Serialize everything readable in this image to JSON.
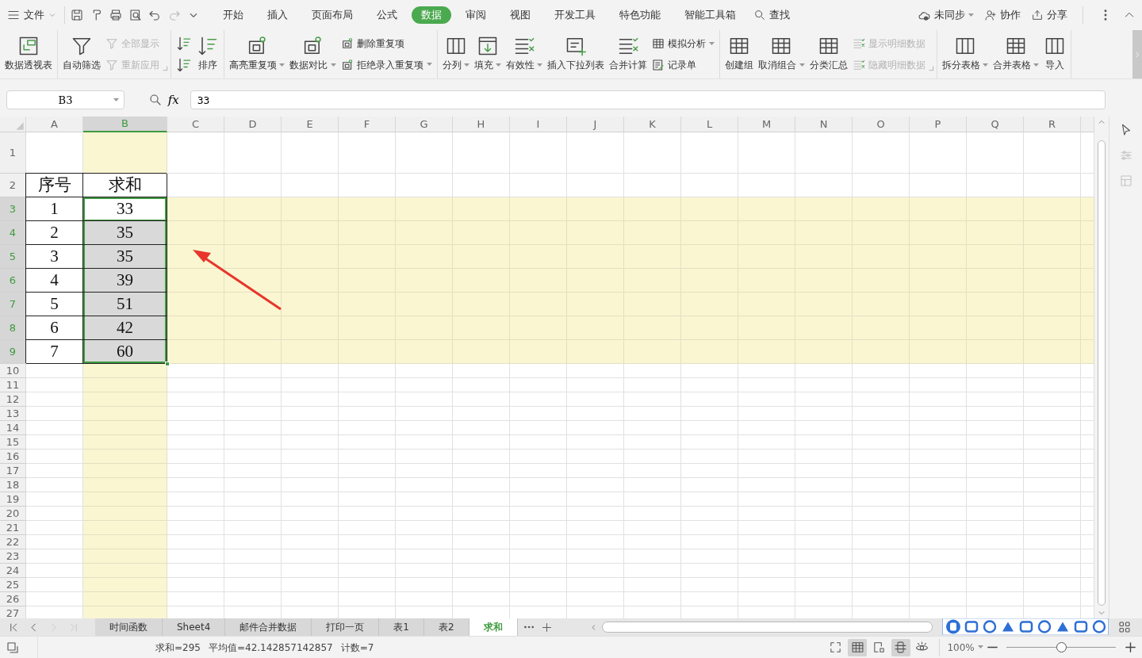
{
  "title_bar": {
    "file_menu": "文件",
    "tabs": [
      {
        "label": "开始",
        "selected": false
      },
      {
        "label": "插入",
        "selected": false
      },
      {
        "label": "页面布局",
        "selected": false
      },
      {
        "label": "公式",
        "selected": false
      },
      {
        "label": "数据",
        "selected": true
      },
      {
        "label": "审阅",
        "selected": false
      },
      {
        "label": "视图",
        "selected": false
      },
      {
        "label": "开发工具",
        "selected": false
      },
      {
        "label": "特色功能",
        "selected": false
      },
      {
        "label": "智能工具箱",
        "selected": false
      }
    ],
    "search": "查找",
    "sync": "未同步",
    "collaborate": "协作",
    "share": "分享"
  },
  "ribbon": {
    "groups": [
      {
        "launcher": false,
        "columns": [
          {
            "kind": "large",
            "label": "数据透视表",
            "dropdown": false,
            "disabled": false
          }
        ]
      },
      {
        "launcher": true,
        "columns": [
          {
            "kind": "large",
            "label": "自动筛选",
            "dropdown": false,
            "disabled": false
          },
          {
            "kind": "stack",
            "items": [
              {
                "label": "全部显示",
                "dropdown": false,
                "disabled": true
              },
              {
                "label": "重新应用",
                "dropdown": false,
                "disabled": true
              }
            ]
          }
        ]
      },
      {
        "launcher": false,
        "columns": [
          {
            "kind": "stack",
            "items": [
              {
                "dropdown": false,
                "disabled": false
              },
              {
                "dropdown": false,
                "disabled": false
              }
            ]
          },
          {
            "kind": "large",
            "label": "排序",
            "dropdown": false,
            "disabled": false
          }
        ]
      },
      {
        "launcher": false,
        "columns": [
          {
            "kind": "large",
            "label": "高亮重复项",
            "dropdown": true,
            "disabled": false
          },
          {
            "kind": "large",
            "label": "数据对比",
            "dropdown": true,
            "disabled": false
          },
          {
            "kind": "stack",
            "items": [
              {
                "label": "删除重复项",
                "dropdown": false,
                "disabled": false
              },
              {
                "label": "拒绝录入重复项",
                "dropdown": true,
                "disabled": false
              }
            ]
          }
        ]
      },
      {
        "launcher": false,
        "columns": [
          {
            "kind": "large",
            "label": "分列",
            "dropdown": true,
            "disabled": false
          },
          {
            "kind": "large",
            "label": "填充",
            "dropdown": true,
            "disabled": false
          },
          {
            "kind": "large",
            "label": "有效性",
            "dropdown": true,
            "disabled": false
          },
          {
            "kind": "large",
            "label": "插入下拉列表",
            "dropdown": false,
            "disabled": false
          },
          {
            "kind": "large",
            "label": "合并计算",
            "dropdown": false,
            "disabled": false
          },
          {
            "kind": "stack",
            "items": [
              {
                "label": "模拟分析",
                "dropdown": true,
                "disabled": false
              },
              {
                "label": "记录单",
                "dropdown": false,
                "disabled": false
              }
            ]
          }
        ]
      },
      {
        "launcher": true,
        "columns": [
          {
            "kind": "large",
            "label": "创建组",
            "dropdown": false,
            "disabled": false
          },
          {
            "kind": "large",
            "label": "取消组合",
            "dropdown": true,
            "disabled": false
          },
          {
            "kind": "large",
            "label": "分类汇总",
            "dropdown": false,
            "disabled": false
          },
          {
            "kind": "stack",
            "items": [
              {
                "label": "显示明细数据",
                "dropdown": false,
                "disabled": true
              },
              {
                "label": "隐藏明细数据",
                "dropdown": false,
                "disabled": true
              }
            ]
          }
        ]
      },
      {
        "launcher": false,
        "columns": [
          {
            "kind": "large",
            "label": "拆分表格",
            "dropdown": true,
            "disabled": false
          },
          {
            "kind": "large",
            "label": "合并表格",
            "dropdown": true,
            "disabled": false
          },
          {
            "kind": "large",
            "label": "导入",
            "dropdown": false,
            "disabled": false
          }
        ]
      }
    ]
  },
  "formula_bar": {
    "name_box": "B3",
    "fx": "fx",
    "formula": "33"
  },
  "sheet": {
    "columns": [
      {
        "label": "A",
        "selected": false
      },
      {
        "label": "B",
        "selected": true
      },
      {
        "label": "C",
        "selected": false
      },
      {
        "label": "D",
        "selected": false
      },
      {
        "label": "E",
        "selected": false
      },
      {
        "label": "F",
        "selected": false
      },
      {
        "label": "G",
        "selected": false
      },
      {
        "label": "H",
        "selected": false
      },
      {
        "label": "I",
        "selected": false
      },
      {
        "label": "J",
        "selected": false
      },
      {
        "label": "K",
        "selected": false
      },
      {
        "label": "L",
        "selected": false
      },
      {
        "label": "M",
        "selected": false
      },
      {
        "label": "N",
        "selected": false
      },
      {
        "label": "O",
        "selected": false
      },
      {
        "label": "P",
        "selected": false
      },
      {
        "label": "Q",
        "selected": false
      },
      {
        "label": "R",
        "selected": false
      }
    ],
    "rows": [
      {
        "label": "1",
        "selected": false
      },
      {
        "label": "2",
        "selected": false,
        "cells": [
          {
            "text": "序号",
            "selected": false,
            "active": false
          },
          {
            "text": "求和",
            "selected": false,
            "active": false
          }
        ]
      },
      {
        "label": "3",
        "selected": true,
        "cells": [
          {
            "text": "1",
            "selected": false,
            "active": false
          },
          {
            "text": "33",
            "selected": true,
            "active": true
          }
        ]
      },
      {
        "label": "4",
        "selected": true,
        "cells": [
          {
            "text": "2",
            "selected": false,
            "active": false
          },
          {
            "text": "35",
            "selected": true,
            "active": false
          }
        ]
      },
      {
        "label": "5",
        "selected": true,
        "cells": [
          {
            "text": "3",
            "selected": false,
            "active": false
          },
          {
            "text": "35",
            "selected": true,
            "active": false
          }
        ]
      },
      {
        "label": "6",
        "selected": true,
        "cells": [
          {
            "text": "4",
            "selected": false,
            "active": false
          },
          {
            "text": "39",
            "selected": true,
            "active": false
          }
        ]
      },
      {
        "label": "7",
        "selected": true,
        "cells": [
          {
            "text": "5",
            "selected": false,
            "active": false
          },
          {
            "text": "51",
            "selected": true,
            "active": false
          }
        ]
      },
      {
        "label": "8",
        "selected": true,
        "cells": [
          {
            "text": "6",
            "selected": false,
            "active": false
          },
          {
            "text": "42",
            "selected": true,
            "active": false
          }
        ]
      },
      {
        "label": "9",
        "selected": true,
        "cells": [
          {
            "text": "7",
            "selected": false,
            "active": false
          },
          {
            "text": "60",
            "selected": true,
            "active": false
          }
        ]
      },
      {
        "label": "10",
        "selected": false
      },
      {
        "label": "11",
        "selected": false
      },
      {
        "label": "12",
        "selected": false
      },
      {
        "label": "13",
        "selected": false
      },
      {
        "label": "14",
        "selected": false
      },
      {
        "label": "15",
        "selected": false
      },
      {
        "label": "16",
        "selected": false
      },
      {
        "label": "17",
        "selected": false
      },
      {
        "label": "18",
        "selected": false
      },
      {
        "label": "19",
        "selected": false
      },
      {
        "label": "20",
        "selected": false
      },
      {
        "label": "21",
        "selected": false
      },
      {
        "label": "22",
        "selected": false
      },
      {
        "label": "23",
        "selected": false
      },
      {
        "label": "24",
        "selected": false
      },
      {
        "label": "25",
        "selected": false
      },
      {
        "label": "26",
        "selected": false
      },
      {
        "label": "27",
        "selected": false
      }
    ]
  },
  "sheet_nav": [
    {
      "disabled": false
    },
    {
      "disabled": false
    },
    {
      "disabled": true
    },
    {
      "disabled": true
    }
  ],
  "sheet_tabs": [
    {
      "label": "时间函数",
      "selected": false
    },
    {
      "label": "Sheet4",
      "selected": false
    },
    {
      "label": "邮件合并数据",
      "selected": false
    },
    {
      "label": "打印一页",
      "selected": false
    },
    {
      "label": "表1",
      "selected": false
    },
    {
      "label": "表2",
      "selected": false
    },
    {
      "label": "求和",
      "selected": true
    }
  ],
  "status_bar": {
    "items": [
      "求和=295",
      "平均值=42.142857142857",
      "计数=7"
    ],
    "view_modes": [
      {
        "selected": false
      },
      {
        "selected": true
      },
      {
        "selected": false
      },
      {
        "selected": true
      },
      {
        "selected": false
      }
    ],
    "zoom": "100%",
    "zoom_slider": {
      "level": 0.5
    }
  }
}
